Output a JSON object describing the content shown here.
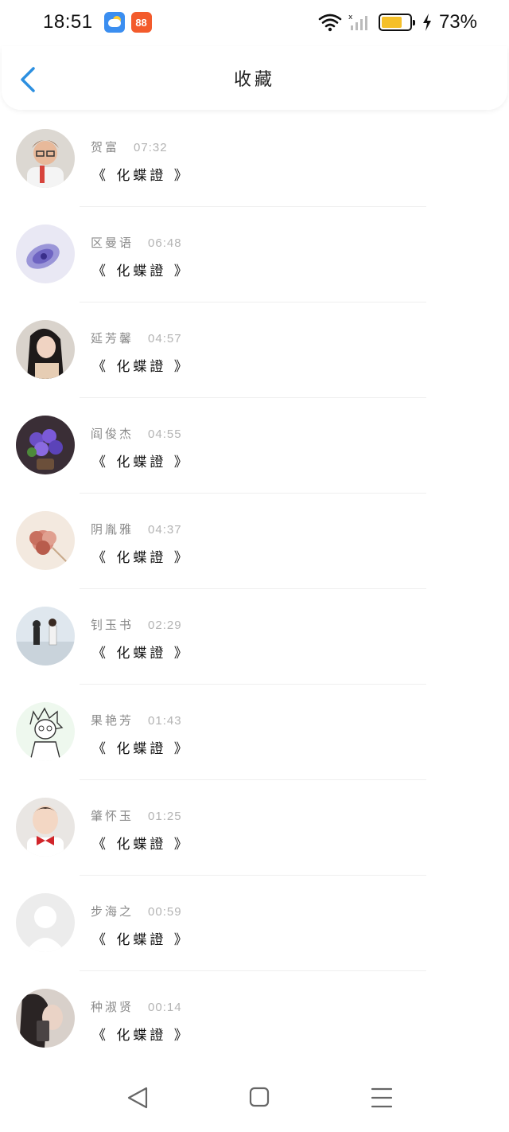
{
  "status_bar": {
    "time": "18:51",
    "shop_icon_text": "88",
    "battery_level": 0.73,
    "battery_percent": "73%",
    "icons": [
      "weather-app-icon",
      "shop-app-icon",
      "wifi-icon",
      "signal-icon",
      "battery-icon",
      "charging-icon"
    ]
  },
  "header": {
    "title": "收藏",
    "back_icon": "chevron-left-icon"
  },
  "colors": {
    "accent": "#2c8fe0",
    "divider": "#efefef",
    "name_text": "#8a8a8a",
    "time_text": "#b3b3b3",
    "battery_fill": "#f5c02a"
  },
  "favorites": [
    {
      "name": "贺富",
      "time": "07:32",
      "message": "《 化蝶證 》"
    },
    {
      "name": "区曼语",
      "time": "06:48",
      "message": "《 化蝶證 》"
    },
    {
      "name": "延芳馨",
      "time": "04:57",
      "message": "《 化蝶證 》"
    },
    {
      "name": "阎俊杰",
      "time": "04:55",
      "message": "《 化蝶證 》"
    },
    {
      "name": "阴胤雅",
      "time": "04:37",
      "message": "《 化蝶證 》"
    },
    {
      "name": "钊玉书",
      "time": "02:29",
      "message": "《 化蝶證 》"
    },
    {
      "name": "果艳芳",
      "time": "01:43",
      "message": "《 化蝶證 》"
    },
    {
      "name": "肇怀玉",
      "time": "01:25",
      "message": "《 化蝶證 》"
    },
    {
      "name": "步海之",
      "time": "00:59",
      "message": "《 化蝶證 》"
    },
    {
      "name": "种淑贤",
      "time": "00:14",
      "message": "《 化蝶證 》"
    }
  ],
  "nav_bar": {
    "icons": [
      "back-triangle-icon",
      "home-square-icon",
      "menu-lines-icon"
    ]
  }
}
